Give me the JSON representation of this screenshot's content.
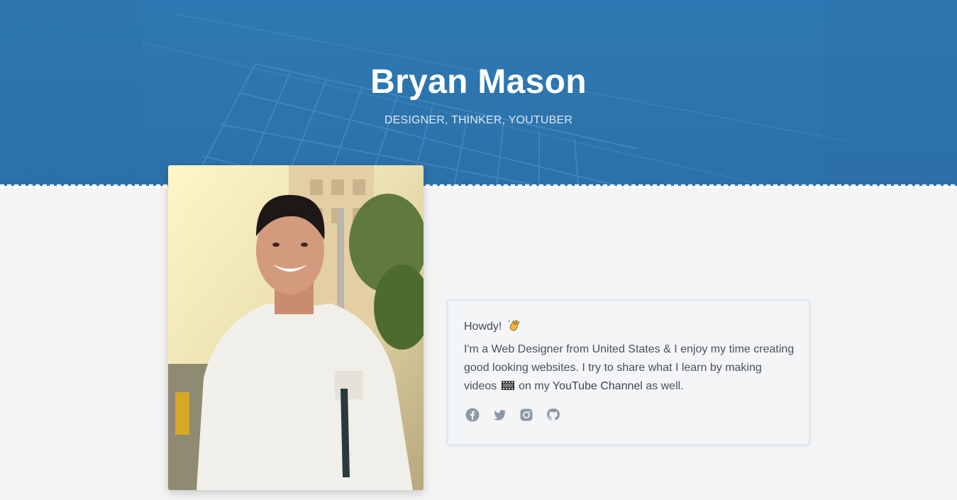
{
  "hero": {
    "name": "Bryan Mason",
    "tagline": "DESIGNER, THINKER, YOUTUBER"
  },
  "about": {
    "greeting": "Howdy!",
    "bio_part1": "I'm a Web Designer from United States & I enjoy my time creating good looking websites. I try to share what I learn by making videos",
    "bio_part2": "on my",
    "youtube_link": "YouTube Channel",
    "bio_part3": "as well."
  },
  "socials": [
    {
      "name": "facebook-icon"
    },
    {
      "name": "twitter-icon"
    },
    {
      "name": "instagram-icon"
    },
    {
      "name": "github-icon"
    }
  ],
  "colors": {
    "hero": "#2e79b3",
    "page_bg": "#f4f4f4",
    "card_border": "#dbe7f3",
    "icon": "#8d99a6",
    "text": "#4a515b"
  }
}
